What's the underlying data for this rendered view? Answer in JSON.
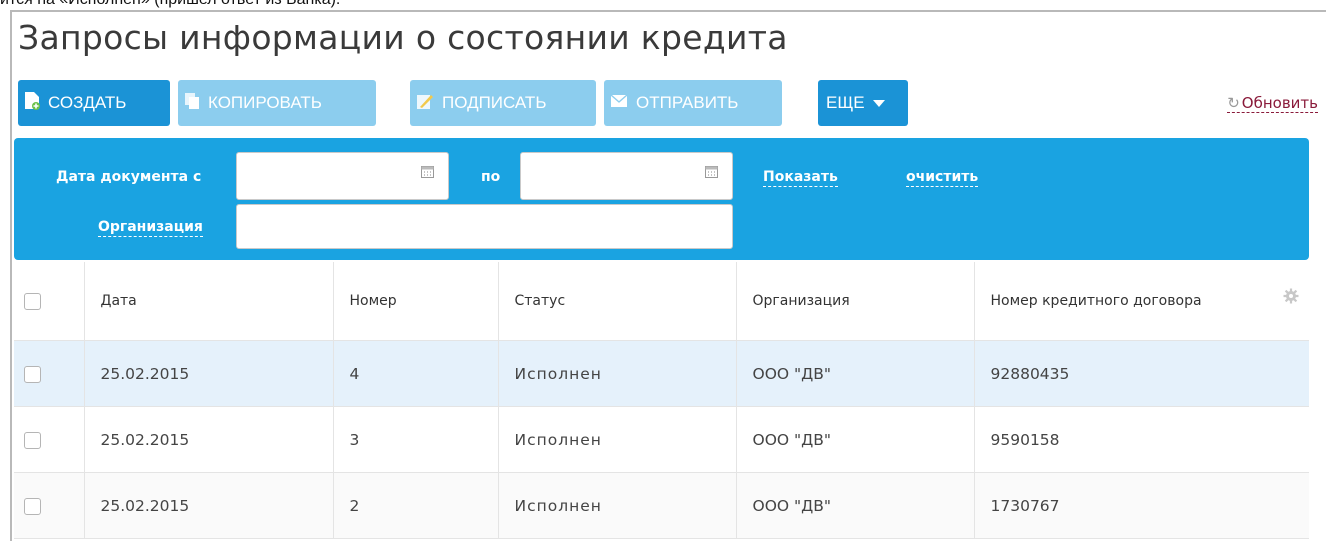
{
  "caption": "ится на «Исполнен» (пришел ответ из Банка).",
  "page_title": "Запросы информации о состоянии кредита",
  "toolbar": {
    "create": "СОЗДАТЬ",
    "copy": "КОПИРОВАТЬ",
    "sign": "ПОДПИСАТЬ",
    "send": "ОТПРАВИТЬ",
    "more": "ЕЩЕ",
    "refresh": "Обновить"
  },
  "filter": {
    "date_from_label": "Дата документа с",
    "date_to_label": "по",
    "date_from_value": "",
    "date_to_value": "",
    "show_link": "Показать",
    "clear_link": "очистить",
    "org_label": "Организация",
    "org_value": ""
  },
  "table": {
    "columns": [
      "Дата",
      "Номер",
      "Статус",
      "Организация",
      "Номер кредитного договора"
    ],
    "rows": [
      {
        "date": "25.02.2015",
        "number": "4",
        "status": "Исполнен",
        "org": "ООО \"ДВ\"",
        "contract": "92880435"
      },
      {
        "date": "25.02.2015",
        "number": "3",
        "status": "Исполнен",
        "org": "ООО \"ДВ\"",
        "contract": "9590158"
      },
      {
        "date": "25.02.2015",
        "number": "2",
        "status": "Исполнен",
        "org": "ООО \"ДВ\"",
        "contract": "1730767"
      }
    ]
  },
  "icons": {
    "create": "new-document-icon",
    "copy": "copy-icon",
    "sign": "sign-pen-icon",
    "send": "envelope-icon",
    "refresh": "refresh-icon",
    "calendar": "calendar-icon",
    "settings": "gear-icon"
  },
  "colors": {
    "primary": "#1b93d6",
    "disabled": "#8ccdee",
    "filter_bg": "#1aa3e1",
    "selected_row": "#e5f1fb",
    "refresh_link": "#8a1a3a"
  }
}
